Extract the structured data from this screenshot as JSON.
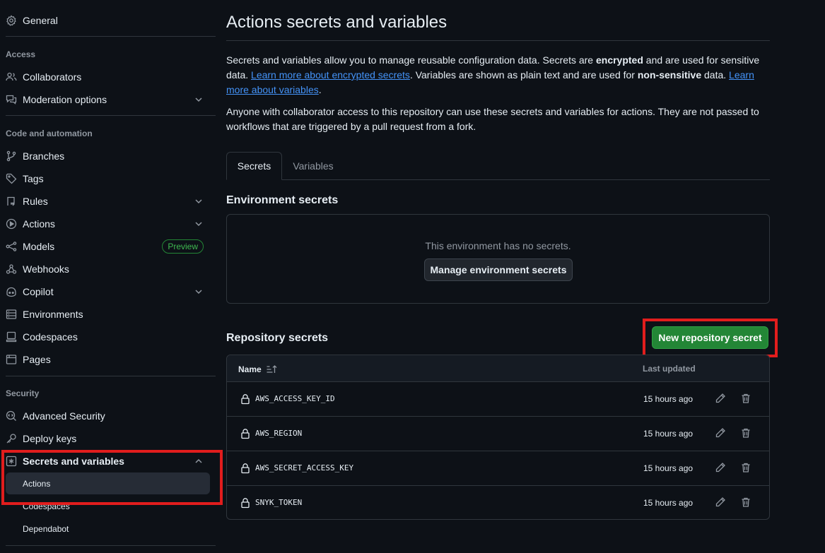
{
  "sidebar": {
    "general": "General",
    "access_heading": "Access",
    "collaborators": "Collaborators",
    "moderation": "Moderation options",
    "code_heading": "Code and automation",
    "branches": "Branches",
    "tags": "Tags",
    "rules": "Rules",
    "actions": "Actions",
    "models": "Models",
    "models_badge": "Preview",
    "webhooks": "Webhooks",
    "copilot": "Copilot",
    "environments": "Environments",
    "codespaces": "Codespaces",
    "pages": "Pages",
    "security_heading": "Security",
    "advanced_security": "Advanced Security",
    "deploy_keys": "Deploy keys",
    "secrets_variables": "Secrets and variables",
    "sub_actions": "Actions",
    "sub_codespaces": "Codespaces",
    "sub_dependabot": "Dependabot"
  },
  "main": {
    "title": "Actions secrets and variables",
    "desc1_a": "Secrets and variables allow you to manage reusable configuration data. Secrets are ",
    "desc1_b": "encrypted",
    "desc1_c": " and are used for sensitive data. ",
    "desc1_link1": "Learn more about encrypted secrets",
    "desc1_d": ". Variables are shown as plain text and are used for ",
    "desc1_e": "non-sensitive",
    "desc1_f": " data. ",
    "desc1_link2": "Learn more about variables",
    "desc1_g": ".",
    "desc2": "Anyone with collaborator access to this repository can use these secrets and variables for actions. They are not passed to workflows that are triggered by a pull request from a fork.",
    "tabs": {
      "secrets": "Secrets",
      "variables": "Variables"
    },
    "env_title": "Environment secrets",
    "env_empty": "This environment has no secrets.",
    "manage_env_button": "Manage environment secrets",
    "repo_title": "Repository secrets",
    "new_secret_button": "New repository secret",
    "table": {
      "col_name": "Name",
      "col_updated": "Last updated",
      "rows": [
        {
          "name": "AWS_ACCESS_KEY_ID",
          "updated": "15 hours ago"
        },
        {
          "name": "AWS_REGION",
          "updated": "15 hours ago"
        },
        {
          "name": "AWS_SECRET_ACCESS_KEY",
          "updated": "15 hours ago"
        },
        {
          "name": "SNYK_TOKEN",
          "updated": "15 hours ago"
        }
      ]
    }
  },
  "colors": {
    "background": "#0d1117",
    "border": "#30363d",
    "primary_button": "#238636",
    "link": "#4493f8",
    "highlight": "#e11d1d"
  }
}
